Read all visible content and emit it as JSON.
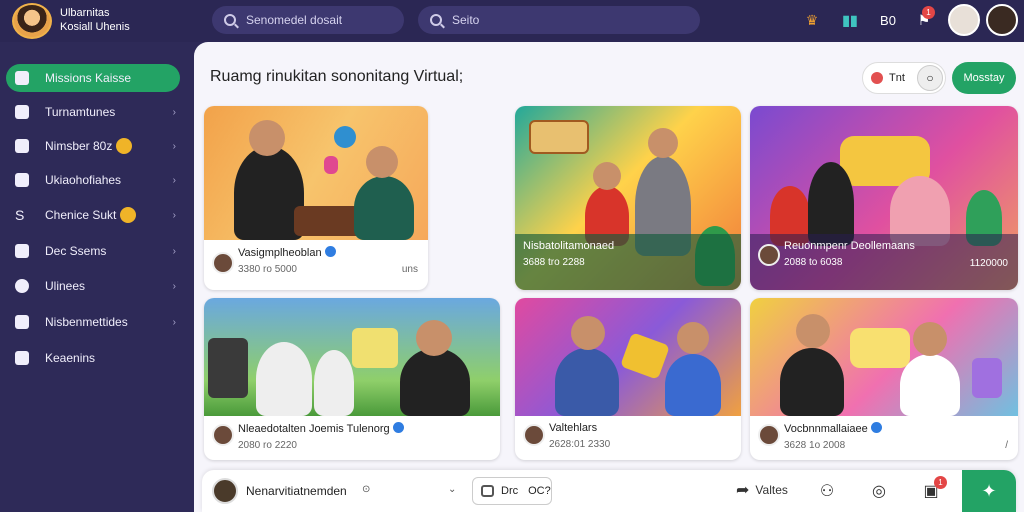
{
  "header": {
    "brand_line1": "Ulbarnitas",
    "brand_line2": "Kosiall Uhenis",
    "search1_placeholder": "Senomedel dosait",
    "search2_placeholder": "Seito",
    "label_b0": "B0",
    "notif_count": "1"
  },
  "sidebar": {
    "items": [
      {
        "label": "Missions Kaisse"
      },
      {
        "label": "Turnamtunes"
      },
      {
        "label": "Nimsber 80z"
      },
      {
        "label": "Ukiaohofiahes"
      },
      {
        "label": "Chenice Sukt"
      },
      {
        "label": "Dec Ssems"
      },
      {
        "label": "Ulinees"
      },
      {
        "label": "Nisbenmettides"
      },
      {
        "label": "Keaenins"
      }
    ]
  },
  "main": {
    "title": "Ruamg rinukitan sononitang Virtual;",
    "toggle_label": "Tnt",
    "primary_button": "Mosstay"
  },
  "cards": [
    {
      "name": "Vasigmplheoblan",
      "stats": "3380 ro 5000",
      "right": "uns"
    },
    {
      "name": "Nisbatolitamonaed",
      "stats": "3688 tro 2288",
      "right": ""
    },
    {
      "name": "Reuonmpenr Deollemaans",
      "stats": "2088 to 6038",
      "right": "1120000"
    },
    {
      "name": "Nleaedotalten Joemis Tulenorg",
      "stats": "2080 ro 2220",
      "right": ""
    },
    {
      "name": "Valtehlars",
      "stats": "2628:01 2330",
      "right": ""
    },
    {
      "name": "Vocbnnmallaiaee",
      "stats": "3628 1o 2008",
      "right": "/"
    }
  ],
  "bottombar": {
    "name": "Nenarvitiatnemden",
    "chip_label": "Drc",
    "chip_suffix": "OC?",
    "action_label": "Valtes",
    "notif_count": "1"
  },
  "colors": {
    "accent_green": "#23a365",
    "sidebar_bg": "#2e2a58",
    "badge_red": "#e34646"
  }
}
